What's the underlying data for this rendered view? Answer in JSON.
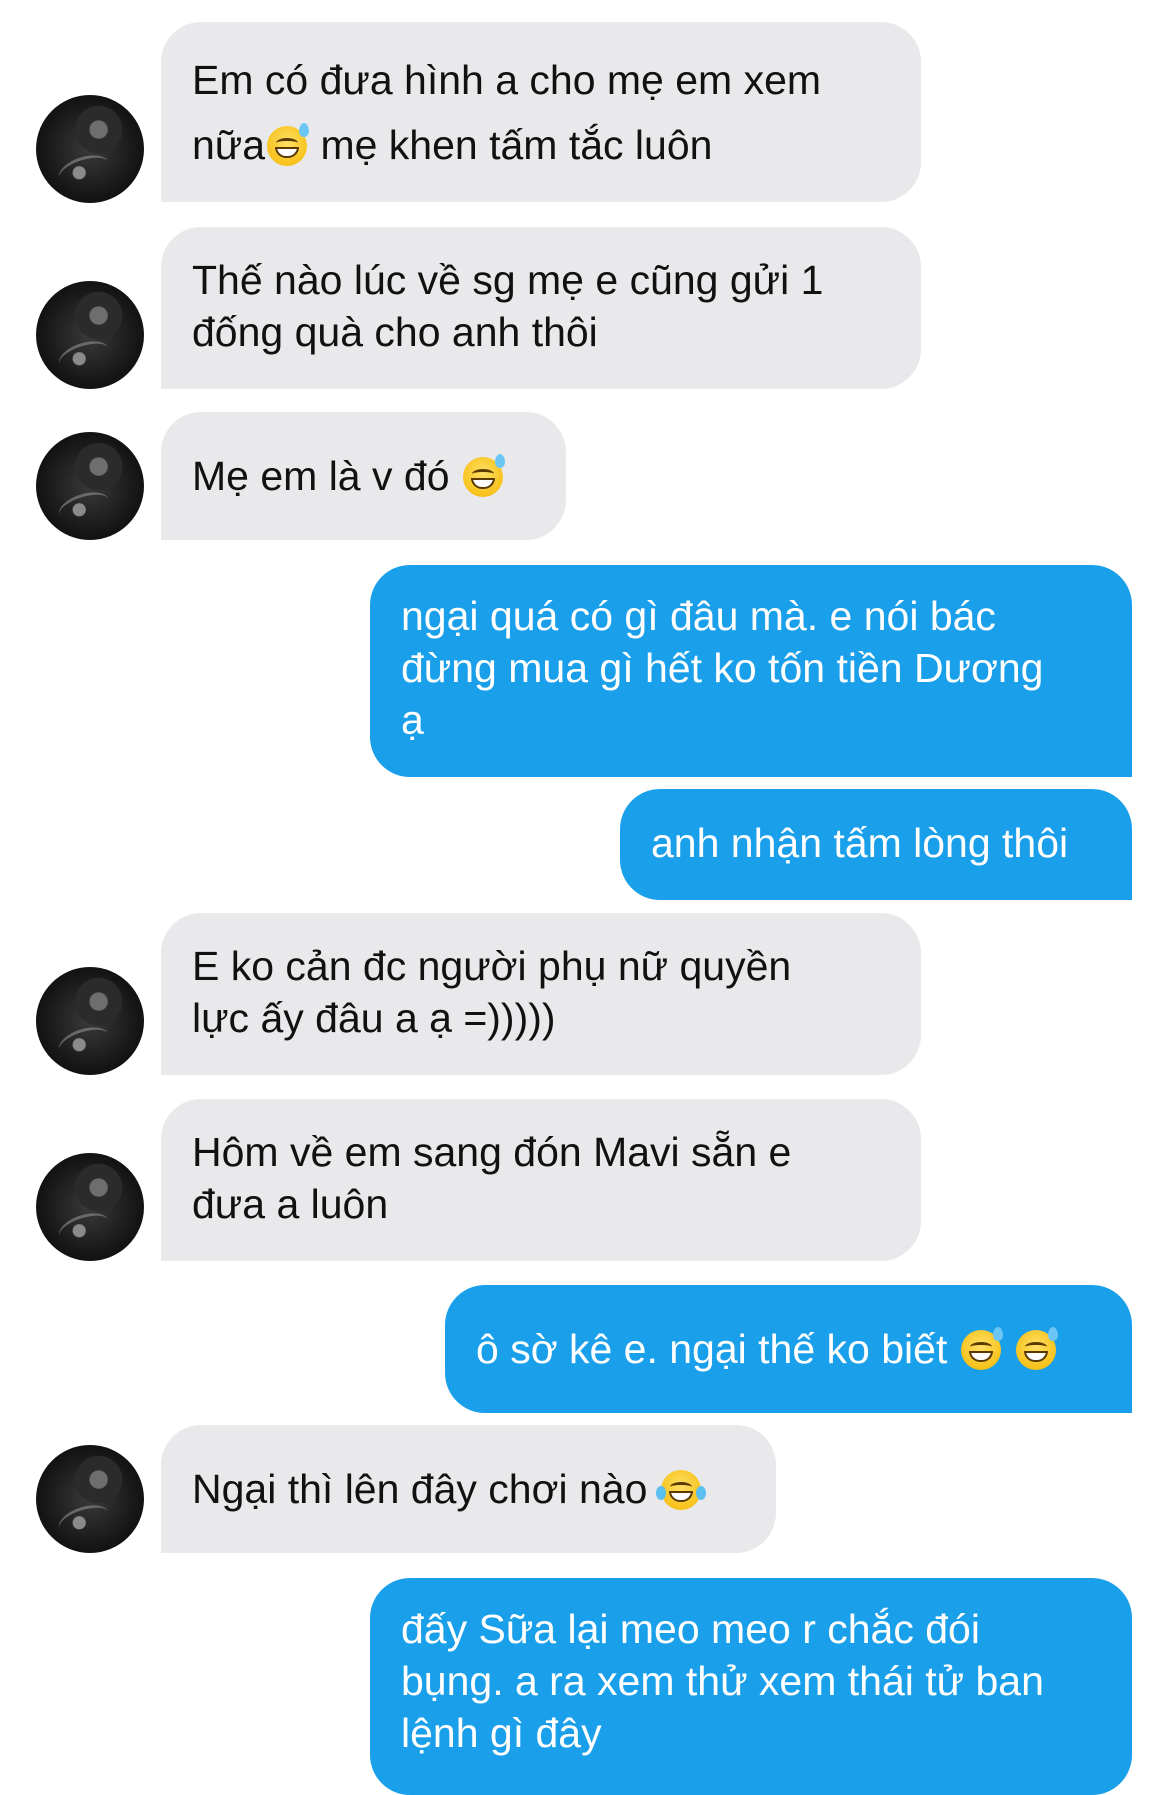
{
  "messages": [
    {
      "side": "in",
      "text": "Em có đưa hình a cho mẹ em xem\nnữa",
      "emoji": "grinning-sweat",
      "tail": " mẹ khen tấm tắc luôn"
    },
    {
      "side": "in",
      "text": "Thế nào lúc về sg mẹ e cũng gửi 1\nđống quà cho anh thôi"
    },
    {
      "side": "in",
      "text": "Mẹ em là v đó ",
      "emoji": "grinning-sweat"
    },
    {
      "side": "out",
      "text": "ngại quá có gì đâu mà. e nói bác\nđừng mua gì hết ko tốn tiền Dương\nạ"
    },
    {
      "side": "out",
      "text": "anh nhận tấm lòng thôi"
    },
    {
      "side": "in",
      "text": "E ko cản đc người phụ nữ quyền\nlực ấy đâu a ạ =)))))"
    },
    {
      "side": "in",
      "text": "Hôm về em sang đón Mavi sẵn e\nđưa a luôn"
    },
    {
      "side": "out",
      "text": "ô sờ kê e. ngại thế ko biết ",
      "emoji": "grinning-sweat",
      "emoji2": "grinning-sweat"
    },
    {
      "side": "in",
      "text": "Ngại thì lên đây chơi nào ",
      "emoji": "tears-of-joy"
    },
    {
      "side": "out",
      "text": "đấy Sữa lại meo meo r chắc đói\nbụng. a ra xem thử xem thái tử ban\nlệnh gì đây"
    }
  ],
  "colors": {
    "incoming_bubble": "#e9e9ec",
    "outgoing_bubble": "#1a9fea",
    "incoming_text": "#111111",
    "outgoing_text": "#ffffff"
  }
}
